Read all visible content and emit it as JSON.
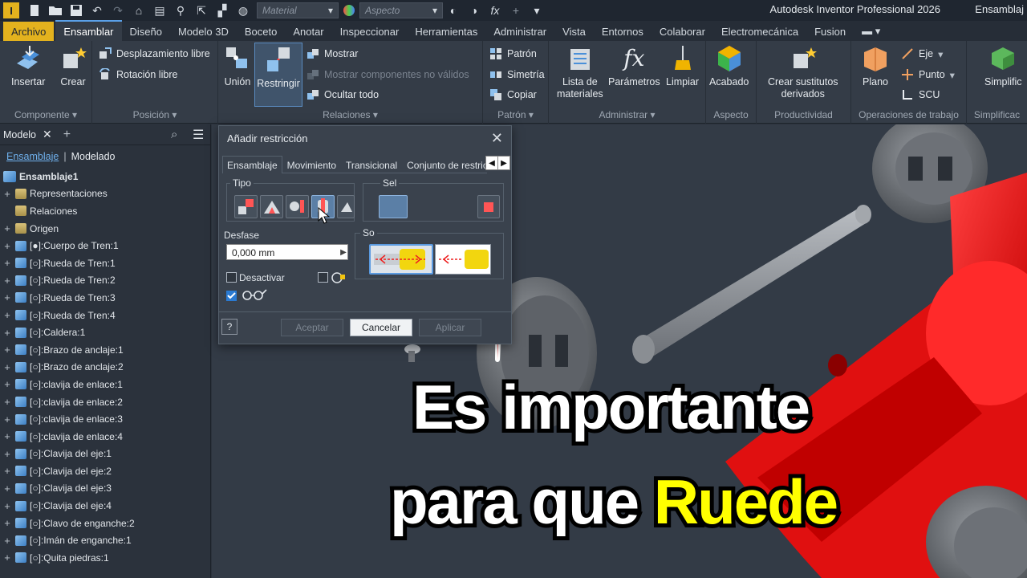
{
  "app": {
    "title": "Autodesk Inventor Professional 2026",
    "document": "Ensamblaj",
    "logo_letter": "I"
  },
  "quick_access": {
    "material_placeholder": "Material",
    "appearance_placeholder": "Aspecto",
    "fx_label": "fx"
  },
  "ribbon_tabs": [
    "Archivo",
    "Ensamblar",
    "Diseño",
    "Modelo 3D",
    "Boceto",
    "Anotar",
    "Inspeccionar",
    "Herramientas",
    "Administrar",
    "Vista",
    "Entornos",
    "Colaborar",
    "Electromecánica",
    "Fusion"
  ],
  "ribbon": {
    "componente": {
      "label": "Componente",
      "insertar": "Insertar",
      "crear": "Crear"
    },
    "posicion": {
      "label": "Posición",
      "desplazamiento": "Desplazamiento libre",
      "rotacion": "Rotación libre"
    },
    "relaciones": {
      "label": "Relaciones",
      "union": "Unión",
      "restringir": "Restringir",
      "mostrar": "Mostrar",
      "mostrar_no_validos": "Mostrar componentes no válidos",
      "ocultar": "Ocultar todo"
    },
    "patron": {
      "label": "Patrón",
      "patron": "Patrón",
      "simetria": "Simetría",
      "copiar": "Copiar"
    },
    "administrar": {
      "label": "Administrar",
      "lista_line1": "Lista de",
      "lista_line2": "materiales",
      "parametros": "Parámetros",
      "limpiar": "Limpiar"
    },
    "aspecto": {
      "label": "Aspecto",
      "acabado": "Acabado"
    },
    "productividad": {
      "label": "Productividad",
      "crear_line1": "Crear sustitutos",
      "crear_line2": "derivados"
    },
    "operaciones": {
      "label": "Operaciones de trabajo",
      "plano": "Plano",
      "eje": "Eje",
      "punto": "Punto",
      "scu": "SCU"
    },
    "simplificacion": {
      "label": "Simplificac",
      "btn": "Simplific"
    }
  },
  "browser": {
    "tab": "Modelo",
    "sub_active": "Ensamblaje",
    "sub_other": "Modelado",
    "root": "Ensamblaje1",
    "folders": [
      "Representaciones",
      "Relaciones",
      "Origen"
    ],
    "items": [
      "[●]:Cuerpo de Tren:1",
      "[○]:Rueda de Tren:1",
      "[○]:Rueda de Tren:2",
      "[○]:Rueda de Tren:3",
      "[○]:Rueda de Tren:4",
      "[○]:Caldera:1",
      "[○]:Brazo de anclaje:1",
      "[○]:Brazo de anclaje:2",
      "[○]:clavija de enlace:1",
      "[○]:clavija de enlace:2",
      "[○]:clavija de enlace:3",
      "[○]:clavija de enlace:4",
      "[○]:Clavija del eje:1",
      "[○]:Clavija del eje:2",
      "[○]:Clavija del eje:3",
      "[○]:Clavija del eje:4",
      "[○]:Clavo de enganche:2",
      "[○]:Imán de enganche:1",
      "[○]:Quita piedras:1"
    ]
  },
  "dialog": {
    "title": "Añadir restricción",
    "tabs": [
      "Ensamblaje",
      "Movimiento",
      "Transicional",
      "Conjunto de restricc"
    ],
    "tipo_label": "Tipo",
    "seleccion_label": "Sel",
    "solucion_label": "So",
    "desfase_label": "Desfase",
    "desfase_value": "0,000 mm",
    "desactivar_label": "Desactivar",
    "aceptar": "Aceptar",
    "cancelar": "Cancelar",
    "aplicar": "Aplicar"
  },
  "overlay": {
    "line1": "Es importante",
    "line2_prefix": "para que ",
    "line2_highlight": "Ruede"
  },
  "colors": {
    "accent_yellow": "#ffff00",
    "arrow_red": "#ee1111",
    "train_red": "#ff1a1a",
    "file_tab": "#e3b21e"
  }
}
